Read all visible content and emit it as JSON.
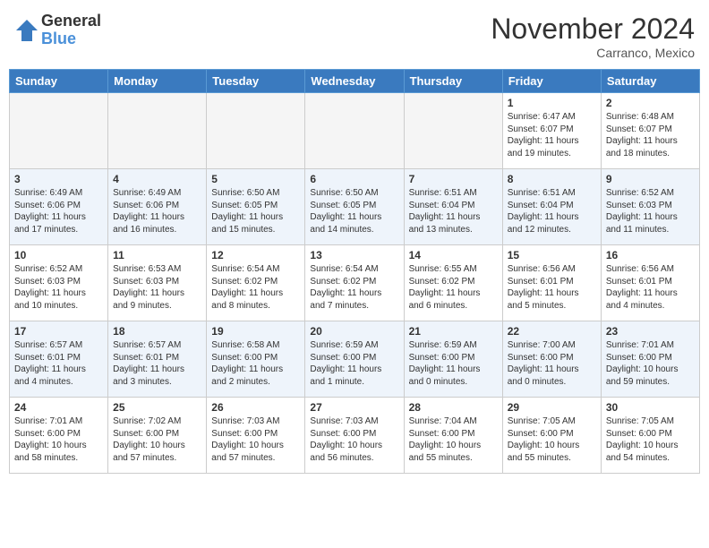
{
  "header": {
    "logo_general": "General",
    "logo_blue": "Blue",
    "month_title": "November 2024",
    "location": "Carranco, Mexico"
  },
  "weekdays": [
    "Sunday",
    "Monday",
    "Tuesday",
    "Wednesday",
    "Thursday",
    "Friday",
    "Saturday"
  ],
  "weeks": [
    {
      "alt": false,
      "days": [
        {
          "num": "",
          "info": ""
        },
        {
          "num": "",
          "info": ""
        },
        {
          "num": "",
          "info": ""
        },
        {
          "num": "",
          "info": ""
        },
        {
          "num": "",
          "info": ""
        },
        {
          "num": "1",
          "info": "Sunrise: 6:47 AM\nSunset: 6:07 PM\nDaylight: 11 hours and 19 minutes."
        },
        {
          "num": "2",
          "info": "Sunrise: 6:48 AM\nSunset: 6:07 PM\nDaylight: 11 hours and 18 minutes."
        }
      ]
    },
    {
      "alt": true,
      "days": [
        {
          "num": "3",
          "info": "Sunrise: 6:49 AM\nSunset: 6:06 PM\nDaylight: 11 hours and 17 minutes."
        },
        {
          "num": "4",
          "info": "Sunrise: 6:49 AM\nSunset: 6:06 PM\nDaylight: 11 hours and 16 minutes."
        },
        {
          "num": "5",
          "info": "Sunrise: 6:50 AM\nSunset: 6:05 PM\nDaylight: 11 hours and 15 minutes."
        },
        {
          "num": "6",
          "info": "Sunrise: 6:50 AM\nSunset: 6:05 PM\nDaylight: 11 hours and 14 minutes."
        },
        {
          "num": "7",
          "info": "Sunrise: 6:51 AM\nSunset: 6:04 PM\nDaylight: 11 hours and 13 minutes."
        },
        {
          "num": "8",
          "info": "Sunrise: 6:51 AM\nSunset: 6:04 PM\nDaylight: 11 hours and 12 minutes."
        },
        {
          "num": "9",
          "info": "Sunrise: 6:52 AM\nSunset: 6:03 PM\nDaylight: 11 hours and 11 minutes."
        }
      ]
    },
    {
      "alt": false,
      "days": [
        {
          "num": "10",
          "info": "Sunrise: 6:52 AM\nSunset: 6:03 PM\nDaylight: 11 hours and 10 minutes."
        },
        {
          "num": "11",
          "info": "Sunrise: 6:53 AM\nSunset: 6:03 PM\nDaylight: 11 hours and 9 minutes."
        },
        {
          "num": "12",
          "info": "Sunrise: 6:54 AM\nSunset: 6:02 PM\nDaylight: 11 hours and 8 minutes."
        },
        {
          "num": "13",
          "info": "Sunrise: 6:54 AM\nSunset: 6:02 PM\nDaylight: 11 hours and 7 minutes."
        },
        {
          "num": "14",
          "info": "Sunrise: 6:55 AM\nSunset: 6:02 PM\nDaylight: 11 hours and 6 minutes."
        },
        {
          "num": "15",
          "info": "Sunrise: 6:56 AM\nSunset: 6:01 PM\nDaylight: 11 hours and 5 minutes."
        },
        {
          "num": "16",
          "info": "Sunrise: 6:56 AM\nSunset: 6:01 PM\nDaylight: 11 hours and 4 minutes."
        }
      ]
    },
    {
      "alt": true,
      "days": [
        {
          "num": "17",
          "info": "Sunrise: 6:57 AM\nSunset: 6:01 PM\nDaylight: 11 hours and 4 minutes."
        },
        {
          "num": "18",
          "info": "Sunrise: 6:57 AM\nSunset: 6:01 PM\nDaylight: 11 hours and 3 minutes."
        },
        {
          "num": "19",
          "info": "Sunrise: 6:58 AM\nSunset: 6:00 PM\nDaylight: 11 hours and 2 minutes."
        },
        {
          "num": "20",
          "info": "Sunrise: 6:59 AM\nSunset: 6:00 PM\nDaylight: 11 hours and 1 minute."
        },
        {
          "num": "21",
          "info": "Sunrise: 6:59 AM\nSunset: 6:00 PM\nDaylight: 11 hours and 0 minutes."
        },
        {
          "num": "22",
          "info": "Sunrise: 7:00 AM\nSunset: 6:00 PM\nDaylight: 11 hours and 0 minutes."
        },
        {
          "num": "23",
          "info": "Sunrise: 7:01 AM\nSunset: 6:00 PM\nDaylight: 10 hours and 59 minutes."
        }
      ]
    },
    {
      "alt": false,
      "days": [
        {
          "num": "24",
          "info": "Sunrise: 7:01 AM\nSunset: 6:00 PM\nDaylight: 10 hours and 58 minutes."
        },
        {
          "num": "25",
          "info": "Sunrise: 7:02 AM\nSunset: 6:00 PM\nDaylight: 10 hours and 57 minutes."
        },
        {
          "num": "26",
          "info": "Sunrise: 7:03 AM\nSunset: 6:00 PM\nDaylight: 10 hours and 57 minutes."
        },
        {
          "num": "27",
          "info": "Sunrise: 7:03 AM\nSunset: 6:00 PM\nDaylight: 10 hours and 56 minutes."
        },
        {
          "num": "28",
          "info": "Sunrise: 7:04 AM\nSunset: 6:00 PM\nDaylight: 10 hours and 55 minutes."
        },
        {
          "num": "29",
          "info": "Sunrise: 7:05 AM\nSunset: 6:00 PM\nDaylight: 10 hours and 55 minutes."
        },
        {
          "num": "30",
          "info": "Sunrise: 7:05 AM\nSunset: 6:00 PM\nDaylight: 10 hours and 54 minutes."
        }
      ]
    }
  ]
}
